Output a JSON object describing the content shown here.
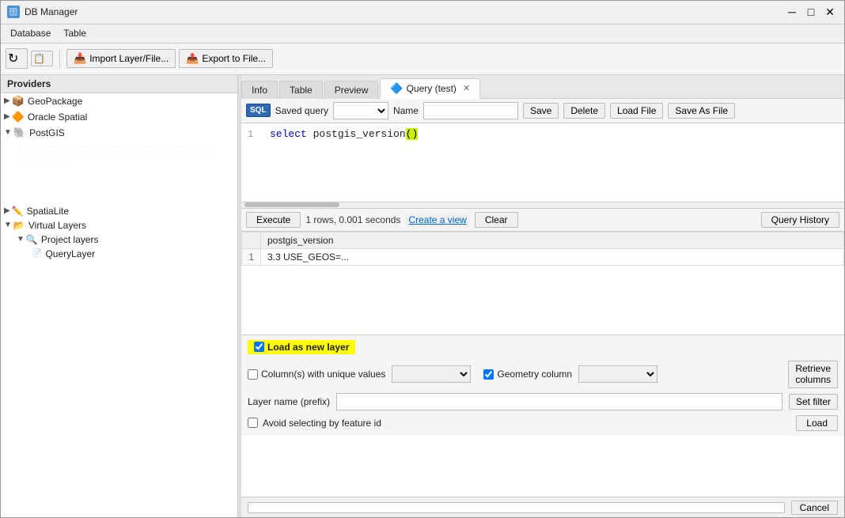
{
  "titlebar": {
    "title": "DB Manager",
    "icon": "🗄",
    "controls": {
      "minimize": "─",
      "maximize": "□",
      "close": "✕"
    }
  },
  "menubar": {
    "items": [
      "Database",
      "Table"
    ]
  },
  "toolbar": {
    "buttons": [
      {
        "label": "↻",
        "name": "refresh"
      },
      {
        "label": "📋",
        "name": "copy"
      },
      {
        "label": "Import Layer/File...",
        "name": "import"
      },
      {
        "label": "Export to File...",
        "name": "export"
      }
    ]
  },
  "sidebar": {
    "title": "Providers",
    "tree": [
      {
        "label": "GeoPackage",
        "level": 0,
        "icon": "📦",
        "expanded": false,
        "type": "geopkg"
      },
      {
        "label": "Oracle Spatial",
        "level": 0,
        "icon": "🔶",
        "expanded": false,
        "type": "oracle"
      },
      {
        "label": "PostGIS",
        "level": 0,
        "icon": "🐘",
        "expanded": true,
        "type": "postgis"
      },
      {
        "label": "SpatiaLite",
        "level": 0,
        "icon": "💾",
        "expanded": false,
        "type": "spatialite"
      },
      {
        "label": "Virtual Layers",
        "level": 0,
        "icon": "📂",
        "expanded": true,
        "type": "virtual"
      },
      {
        "label": "Project layers",
        "level": 1,
        "icon": "🔍",
        "expanded": true,
        "type": "project"
      },
      {
        "label": "QueryLayer",
        "level": 2,
        "icon": "📄",
        "expanded": false,
        "type": "layer"
      }
    ]
  },
  "tabs": {
    "items": [
      {
        "label": "Info",
        "active": false
      },
      {
        "label": "Table",
        "active": false
      },
      {
        "label": "Preview",
        "active": false
      },
      {
        "label": "Query (test)",
        "active": true,
        "closeable": true,
        "icon": "🔷"
      }
    ]
  },
  "query_toolbar": {
    "sql_icon": "SQL",
    "saved_query_label": "Saved query",
    "name_label": "Name",
    "name_value": "",
    "buttons": {
      "save": "Save",
      "delete": "Delete",
      "load_file": "Load File",
      "save_as_file": "Save As File"
    }
  },
  "code_editor": {
    "lines": [
      {
        "num": 1,
        "text_before": "select postgis_version",
        "highlight": "()",
        "text_after": ""
      }
    ]
  },
  "execute_bar": {
    "execute_btn": "Execute",
    "result_info": "1 rows, 0.001 seconds",
    "create_view": "Create a view",
    "clear": "Clear",
    "query_history": "Query History"
  },
  "results": {
    "columns": [
      "postgis_version"
    ],
    "rows": [
      {
        "num": 1,
        "values": [
          "3.3 USE_GEOS=..."
        ]
      }
    ]
  },
  "load_layer": {
    "checkbox_label": "Load as new layer",
    "checked": true,
    "unique_values_label": "Column(s) with unique values",
    "unique_values_checked": false,
    "geometry_column_label": "Geometry column",
    "geometry_column_checked": true,
    "layer_name_label": "Layer name (prefix)",
    "layer_name_value": "",
    "avoid_label": "Avoid selecting by feature id",
    "avoid_checked": false,
    "buttons": {
      "retrieve_columns": "Retrieve\ncolumns",
      "set_filter": "Set filter",
      "load": "Load"
    }
  },
  "statusbar": {
    "cancel_label": "Cancel"
  }
}
